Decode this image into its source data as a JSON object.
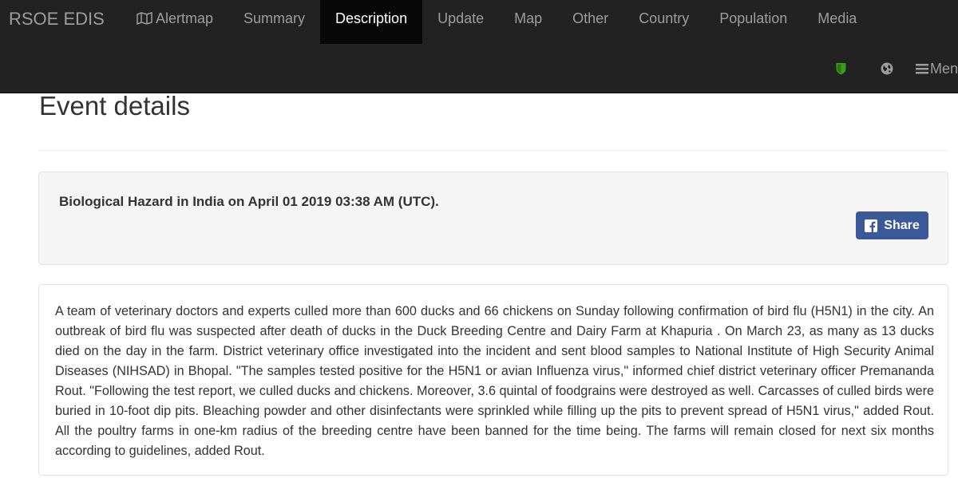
{
  "navbar": {
    "brand": "RSOE EDIS",
    "items": [
      {
        "label": "Alertmap",
        "icon": "map-icon",
        "active": false
      },
      {
        "label": "Summary",
        "active": false
      },
      {
        "label": "Description",
        "active": true
      },
      {
        "label": "Update",
        "active": false
      },
      {
        "label": "Map",
        "active": false
      },
      {
        "label": "Other",
        "active": false
      },
      {
        "label": "Country",
        "active": false
      },
      {
        "label": "Population",
        "active": false
      },
      {
        "label": "Media",
        "active": false
      }
    ],
    "secondary": {
      "shield_icon": "shield-icon",
      "shield_color": "#3c9a1e",
      "globe_icon": "globe-icon",
      "menu_icon": "hamburger-menu-icon",
      "menu_label": "Men"
    }
  },
  "page": {
    "title": "Event details"
  },
  "event": {
    "title": "Biological Hazard in India on April 01 2019 03:38 AM (UTC).",
    "share_label": "Share",
    "share_icon": "facebook-icon",
    "share_color": "#3b5998",
    "description": "A team of veterinary doctors and experts culled more than 600 ducks and 66 chickens on Sunday following confirmation of bird flu (H5N1) in the city. An outbreak of bird flu was suspected after death of ducks in the Duck Breeding Centre and Dairy Farm at Khapuria . On March 23, as many as 13 ducks died on the day in the farm. District veterinary office investigated into the incident and sent blood samples to National Institute of High Security Animal Diseases (NIHSAD) in Bhopal. \"The samples tested positive for the H5N1 or avian Influenza virus,\" informed chief district veterinary officer Premananda Rout. \"Following the test report, we culled ducks and chickens. Moreover, 3.6 quintal of foodgrains were destroyed as well. Carcasses of culled birds were buried in 10-foot dip pits. Bleaching powder and other disinfectants were sprinkled while filling up the pits to prevent spread of H5N1 virus,\" added Rout. All the poultry farms in one-km radius of the breeding centre have been banned for the time being. The farms will remain closed for next six months according to guidelines, added Rout."
  }
}
